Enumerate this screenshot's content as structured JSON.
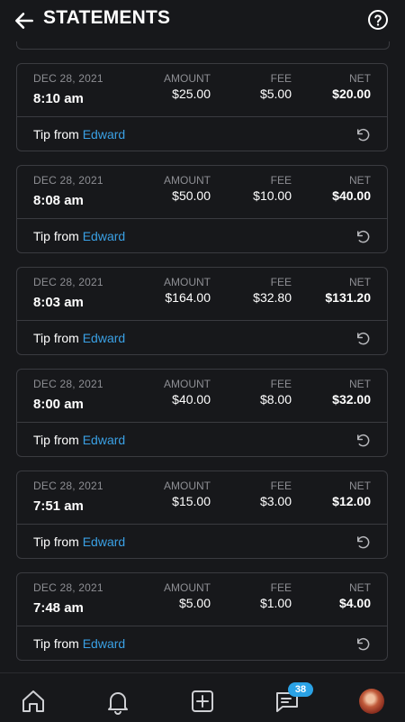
{
  "header": {
    "title": "STATEMENTS"
  },
  "labels": {
    "amount": "AMOUNT",
    "fee": "FEE",
    "net": "NET",
    "tip_prefix": "Tip from"
  },
  "statements": [
    {
      "date": "DEC 28, 2021",
      "time": "8:10 am",
      "amount": "$25.00",
      "fee": "$5.00",
      "net": "$20.00",
      "from": "Edward"
    },
    {
      "date": "DEC 28, 2021",
      "time": "8:08 am",
      "amount": "$50.00",
      "fee": "$10.00",
      "net": "$40.00",
      "from": "Edward"
    },
    {
      "date": "DEC 28, 2021",
      "time": "8:03 am",
      "amount": "$164.00",
      "fee": "$32.80",
      "net": "$131.20",
      "from": "Edward"
    },
    {
      "date": "DEC 28, 2021",
      "time": "8:00 am",
      "amount": "$40.00",
      "fee": "$8.00",
      "net": "$32.00",
      "from": "Edward"
    },
    {
      "date": "DEC 28, 2021",
      "time": "7:51 am",
      "amount": "$15.00",
      "fee": "$3.00",
      "net": "$12.00",
      "from": "Edward"
    },
    {
      "date": "DEC 28, 2021",
      "time": "7:48 am",
      "amount": "$5.00",
      "fee": "$1.00",
      "net": "$4.00",
      "from": "Edward"
    }
  ],
  "tabbar": {
    "items": [
      {
        "icon": "home-icon"
      },
      {
        "icon": "bell-icon"
      },
      {
        "icon": "add-post-icon"
      },
      {
        "icon": "messages-icon"
      },
      {
        "icon": "avatar"
      }
    ],
    "messages_badge": "38"
  },
  "colors": {
    "accent": "#3aa0e4",
    "badge": "#2aa2e6",
    "background": "#17181b",
    "border": "#3a3b40",
    "muted": "#8d8e93"
  }
}
